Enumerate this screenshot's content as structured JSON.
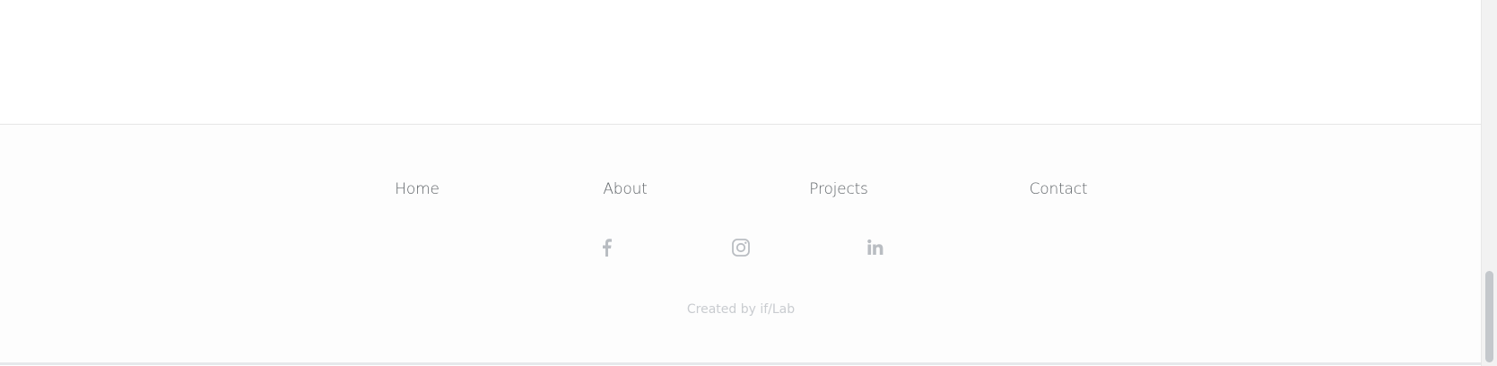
{
  "footer": {
    "nav": {
      "home": "Home",
      "about": "About",
      "projects": "Projects",
      "contact": "Contact"
    },
    "social": [
      {
        "name": "facebook-icon"
      },
      {
        "name": "instagram-icon"
      },
      {
        "name": "linkedin-icon"
      }
    ],
    "credit": {
      "prefix": "Created by ",
      "link": "if/Lab"
    }
  },
  "colors": {
    "nav_text": "#5f6468",
    "icon": "#b9bdc2",
    "credit": "#c9ccd0",
    "divider": "#e6e6e6"
  }
}
